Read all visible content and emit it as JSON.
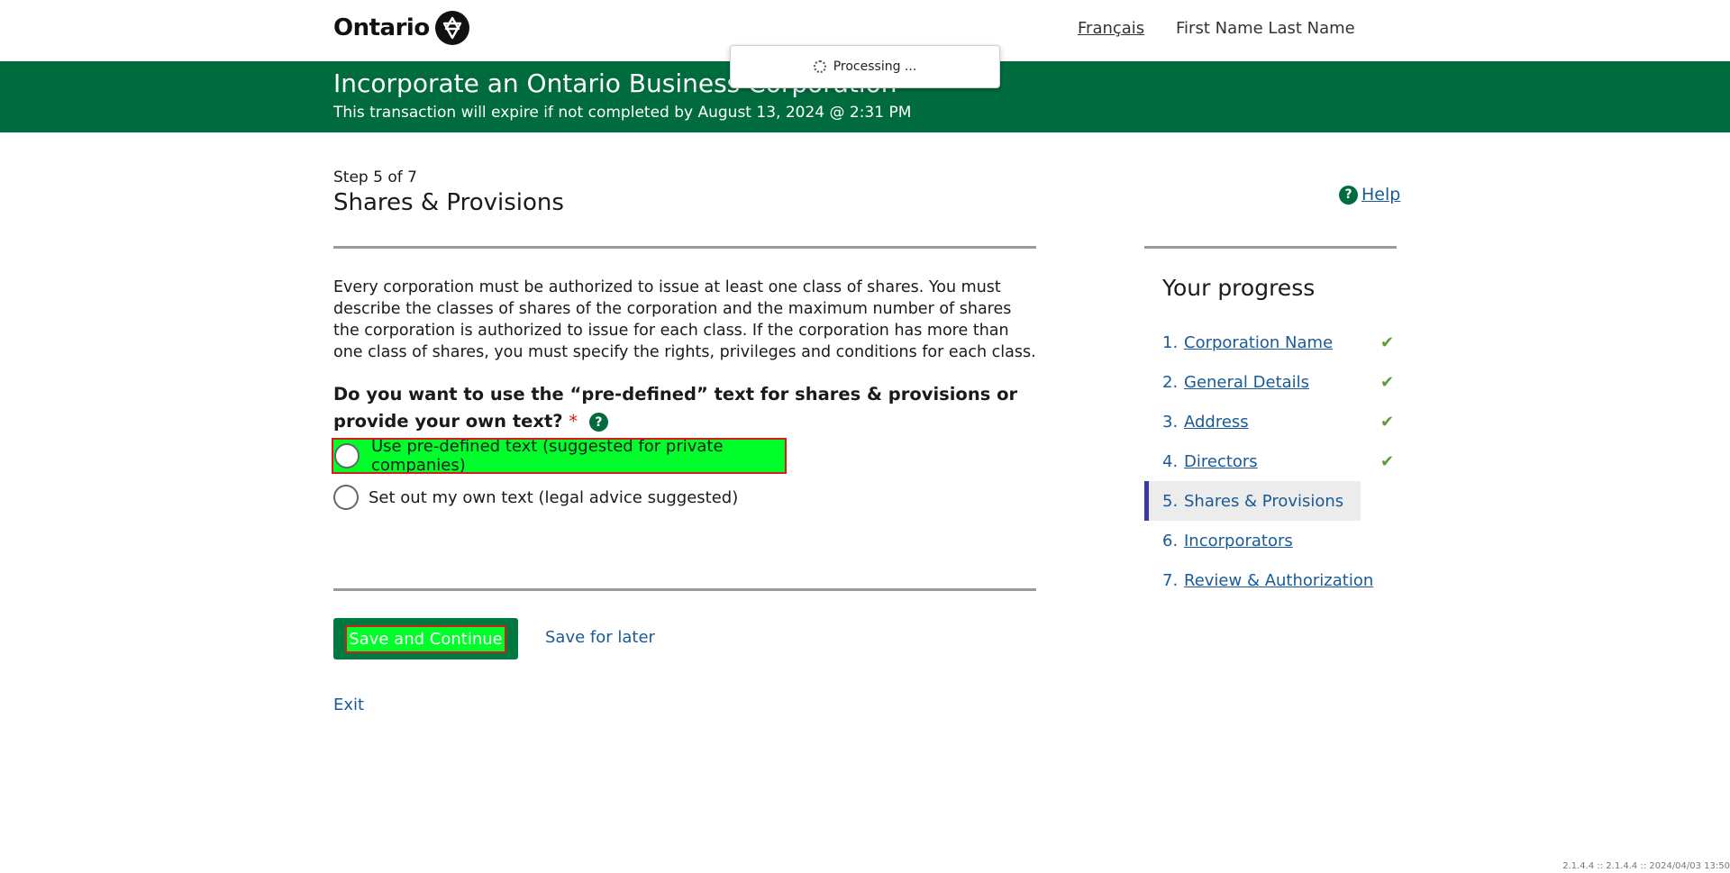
{
  "header": {
    "logo_text": "Ontario",
    "language_link": "Français",
    "user_name": "First Name Last Name"
  },
  "toast": {
    "text": "Processing ..."
  },
  "banner": {
    "title": "Incorporate an Ontario Business Corporation",
    "subtitle": "This transaction will expire if not completed by August 13, 2024 @ 2:31 PM"
  },
  "step": {
    "label": "Step 5 of 7",
    "title": "Shares & Provisions",
    "help_label": "Help"
  },
  "main": {
    "description": "Every corporation must be authorized to issue at least one class of shares. You must describe the classes of shares of the corporation and the maximum number of shares the corporation is authorized to issue for each class. If the corporation has more than one class of shares, you must specify the rights, privileges and conditions for each class.",
    "question": "Do you want to use the “pre-defined” text for shares & provisions or provide your own text?",
    "required_mark": "*",
    "options": [
      {
        "label": "Use pre-defined text (suggested for private companies)",
        "selected": false
      },
      {
        "label": "Set out my own text (legal advice suggested)",
        "selected": false
      }
    ]
  },
  "actions": {
    "save_continue": "Save and Continue",
    "save_later": "Save for later",
    "exit": "Exit"
  },
  "progress": {
    "title": "Your progress",
    "items": [
      {
        "num": "1.",
        "label": "Corporation Name",
        "complete": true
      },
      {
        "num": "2.",
        "label": "General Details",
        "complete": true
      },
      {
        "num": "3.",
        "label": "Address",
        "complete": true
      },
      {
        "num": "4.",
        "label": "Directors",
        "complete": true
      },
      {
        "num": "5.",
        "label": "Shares & Provisions",
        "complete": false
      },
      {
        "num": "6.",
        "label": "Incorporators",
        "complete": false
      },
      {
        "num": "7.",
        "label": "Review & Authorization",
        "complete": false
      }
    ]
  },
  "footer": {
    "version": "2.1.4.4 :: 2.1.4.4 :: 2024/04/03 13:50"
  },
  "colors": {
    "brand_green": "#006b3e",
    "link_blue": "#1a5a96",
    "highlight": "#00ff2a",
    "required_red": "#d81a21"
  }
}
